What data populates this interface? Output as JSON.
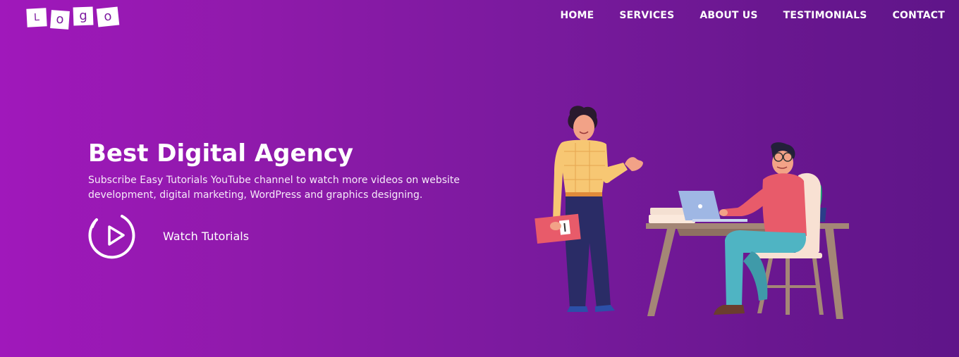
{
  "logo": {
    "letters": [
      "L",
      "o",
      "g",
      "o"
    ]
  },
  "nav": {
    "items": [
      "HOME",
      "SERVICES",
      "ABOUT US",
      "TESTIMONIALS",
      "CONTACT"
    ]
  },
  "hero": {
    "title": "Best Digital Agency",
    "description_line1": "Subscribe Easy Tutorials YouTube channel to watch more videos on website",
    "description_line2": "development, digital marketing, WordPress and graphics designing.",
    "cta_label": "Watch Tutorials"
  },
  "icons": {
    "play": "play-circle-icon"
  },
  "colors": {
    "gradient_start": "#a018bb",
    "gradient_end": "#5f1589",
    "text": "#ffffff"
  }
}
